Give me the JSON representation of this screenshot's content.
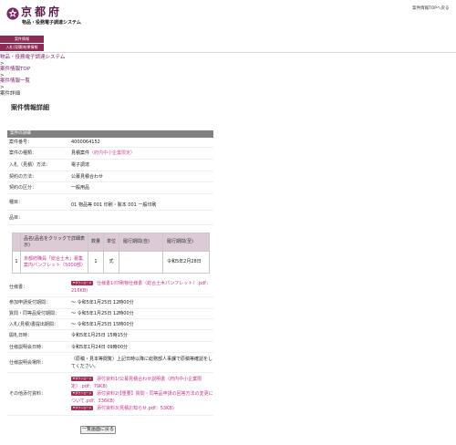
{
  "header": {
    "emblem_icon": "kyoto-prefecture-emblem-icon",
    "logo_text": "京都府",
    "system_name": "物品・役務電子調達システム",
    "back_to_top_link": "案件情報TOPへ戻る"
  },
  "tabs": [
    {
      "label": "案件情報"
    },
    {
      "label": "入札(見積)結果情報"
    }
  ],
  "breadcrumb": {
    "separator": ">",
    "items": [
      {
        "label": "物品・役務電子調達システム"
      },
      {
        "label": "案件情報TOP"
      },
      {
        "label": "案件情報一覧"
      },
      {
        "label": "案件詳細"
      }
    ]
  },
  "page_title": "案件情報詳細",
  "section_title": "案件の詳細",
  "details": {
    "case_number": {
      "label": "案件番号：",
      "value": "4000064152"
    },
    "case_type": {
      "label": "案件の種類：",
      "value": "見積案件",
      "note": "（府内中小企業限定）"
    },
    "bid_method": {
      "label": "入札（見積）方法：",
      "value": "電子調達"
    },
    "contract_method": {
      "label": "契約の方法：",
      "value": "公募見積合わせ"
    },
    "contract_category": {
      "label": "契約の区分：",
      "value": "一般用品"
    },
    "item_class": {
      "label": "種目：",
      "value": "01 物品等 001 印刷・製本 001 一般印刷"
    },
    "items_label": "品目："
  },
  "items_table": {
    "headers": [
      "",
      "品名(品名をクリックで詳細表示)",
      "数量",
      "単位",
      "履行期間(自)",
      "履行期間(至)"
    ],
    "rows": [
      {
        "no": "1",
        "name": "京都府職員「総合土木」募集案内パンフレット（5000部）",
        "quantity": "1",
        "unit": "式",
        "period_from": "",
        "period_to": "令和5年2月28日"
      }
    ]
  },
  "specification": {
    "label": "仕様書：",
    "files": [
      {
        "link": "仕様書1(印刷物仕様書（総合土木パンフレット）.pdf：216KB)"
      }
    ]
  },
  "schedule": [
    {
      "label": "参加申請受付期間：",
      "value": "〜 令和5年1月25日 12時00分"
    },
    {
      "label": "質問・同等品受付期間：",
      "value": "〜 令和5年1月25日 12時00分"
    },
    {
      "label": "入札(見積)書提出期間：",
      "value": "〜 令和5年1月25日 15時00分"
    },
    {
      "label": "開札日時：",
      "value": "令和5年1月25日 15時15分"
    },
    {
      "label": "仕様説明会日時：",
      "value": "令和5年1月24日 09時00分"
    }
  ],
  "briefing_place": {
    "label": "仕様説明会場所：",
    "value": "（原稿・見本等閲覧）上記日時以降に総務部人事課で原稿等確認をしてください。"
  },
  "attachments": {
    "label": "その他添付資料：",
    "files": [
      {
        "link": "添付資料1(公募見積合わせ説明書（府内中小企業限定）.pdf：79KB)"
      },
      {
        "link": "添付資料2(【重要】質問・同等品申請の回答方法の変更について.pdf：336KB)"
      },
      {
        "link": "添付資料3(見積お知らせ.pdf：53KB)"
      }
    ]
  },
  "download_badge_label": "ダウンロード",
  "back_button": "一覧画面に戻る",
  "colors": {
    "brand": "#8c2b55",
    "logo": "#5b1f4f",
    "link": "#c2388b",
    "section_bar": "#808080",
    "table_header": "#dccad7"
  }
}
